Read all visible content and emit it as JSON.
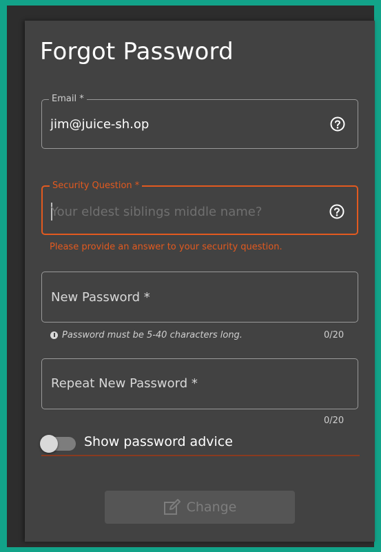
{
  "form": {
    "title": "Forgot Password",
    "email": {
      "label": "Email *",
      "value": "jim@juice-sh.op"
    },
    "security_question": {
      "label": "Security Question *",
      "placeholder": "Your eldest siblings middle name?",
      "error": "Please provide an answer to your security question."
    },
    "new_password": {
      "label": "New Password *",
      "hint": "Password must be 5-40 characters long.",
      "counter": "0/20"
    },
    "repeat_password": {
      "label": "Repeat New Password *",
      "counter": "0/20"
    },
    "toggle": {
      "label": "Show password advice",
      "on": false
    },
    "submit": {
      "label": "Change",
      "disabled": true
    }
  },
  "colors": {
    "background": "#12a389",
    "card": "#424242",
    "error": "#e35a1f",
    "text": "#ffffff"
  },
  "icons": [
    "help-circle-icon",
    "info-icon",
    "edit-icon"
  ]
}
